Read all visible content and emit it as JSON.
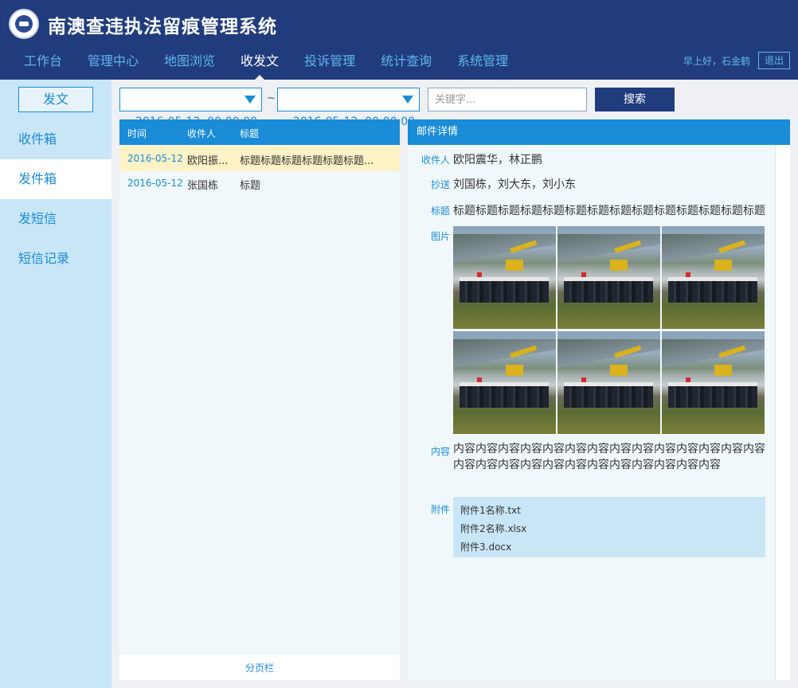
{
  "app": {
    "title": "南澳查违执法留痕管理系统"
  },
  "nav": {
    "items": [
      "工作台",
      "管理中心",
      "地图浏览",
      "收发文",
      "投诉管理",
      "统计查询",
      "系统管理"
    ],
    "active": "收发文"
  },
  "user": {
    "greeting": "早上好，石金鹤",
    "logout": "退出"
  },
  "sidebar": {
    "compose": "发文",
    "items": [
      "收件箱",
      "发件箱",
      "发短信",
      "短信记录"
    ],
    "active": "发件箱"
  },
  "search": {
    "date_from": "2016-05-12  00:00:00",
    "separator": "~",
    "date_to": "2016-05-12  00:00:00",
    "keyword_placeholder": "关键字...",
    "button": "搜索"
  },
  "list": {
    "columns": [
      "时间",
      "收件人",
      "标题"
    ],
    "rows": [
      {
        "date": "2016-05-12",
        "to": "欧阳振...",
        "title": "标题标题标题标题标题标题...",
        "selected": true
      },
      {
        "date": "2016-05-12",
        "to": "张国栋",
        "title": "标题",
        "selected": false
      }
    ],
    "pager": "分页栏"
  },
  "detail": {
    "header": "邮件详情",
    "labels": {
      "to": "收件人",
      "cc": "抄送",
      "subject": "标题",
      "images": "图片",
      "content": "内容",
      "attachments": "附件"
    },
    "to": "欧阳震华，林正鹏",
    "cc": "刘国栋，刘大东，刘小东",
    "subject": "标题标题标题标题标题标题标题标题标题标题标题标题标题标题",
    "content": "内容内容内容内容内容内容内容内容内容内容内容内容内容内容内容内容内容内容内容内容内容内容内容内容内容内容",
    "attachments": [
      "附件1名称.txt",
      "附件2名称.xlsx",
      "附件3.docx"
    ]
  },
  "colors": {
    "header": "#213c7d",
    "accent": "#1a8cd8",
    "sidebar": "#c9e6f6",
    "selected_row": "#fdf3c6"
  }
}
